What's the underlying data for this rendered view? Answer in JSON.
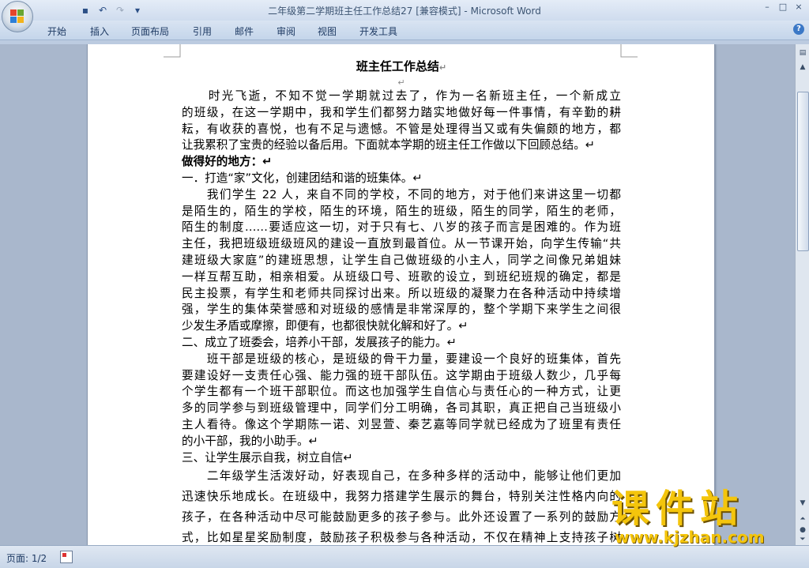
{
  "window": {
    "title_doc": "二年级第二学期班主任工作总结27 [兼容模式] - ",
    "title_app": "Microsoft Word",
    "controls": [
      "–",
      "□",
      "×"
    ]
  },
  "quick_access": {
    "save_icon": "save-icon",
    "undo_icon": "undo-icon",
    "redo_icon": "redo-icon",
    "customize_icon": "customize-icon",
    "save_glyph": "▪",
    "undo_glyph": "↶",
    "redo_glyph": "↷",
    "customize_glyph": "▾"
  },
  "ribbon": {
    "tabs": [
      "开始",
      "插入",
      "页面布局",
      "引用",
      "邮件",
      "审阅",
      "视图",
      "开发工具"
    ],
    "help": "?"
  },
  "document": {
    "title": "班主任工作总结",
    "para_mark": "↵",
    "lines": [
      "　　时光飞逝，不知不觉一学期就过去了，作为一名新班主任，一个新成立",
      "的班级，在这一学期中，我和学生们都努力踏实地做好每一件事情，有辛勤的耕",
      "耘，有收获的喜悦，也有不足与遗憾。不管是处理得当又或有失偏颇的地方，都",
      "让我累积了宝贵的经验以备后用。下面就本学期的班主任工作做以下回顾总结。↵",
      "做得好的地方：↵",
      "一．打造“家”文化，创建团结和谐的班集体。↵",
      "　　我们学生 22 人，来自不同的学校，不同的地方，对于他们来讲这里一切都",
      "是陌生的，陌生的学校，陌生的环境，陌生的班级，陌生的同学，陌生的老师，",
      "陌生的制度……要适应这一切，对于只有七、八岁的孩子而言是困难的。作为班",
      "主任，我把班级班级班风的建设一直放到最首位。从一节课开始，向学生传输“共",
      "建班级大家庭”的建班思想，让学生自己做班级的小主人，同学之间像兄弟姐妹",
      "一样互帮互助，相亲相爱。从班级口号、班歌的设立，到班纪班规的确定，都是",
      "民主投票，有学生和老师共同探讨出来。所以班级的凝聚力在各种活动中持续增",
      "强，学生的集体荣誉感和对班级的感情是非常深厚的，整个学期下来学生之间很",
      "少发生矛盾或摩擦，即便有，也都很快就化解和好了。↵",
      "二、成立了班委会，培养小干部，发展孩子的能力。↵",
      "　　班干部是班级的核心，是班级的骨干力量，要建设一个良好的班集体，首先",
      "要建设好一支责任心强、能力强的班干部队伍。这学期由于班级人数少，几乎每",
      "个学生都有一个班干部职位。而这也加强学生自信心与责任心的一种方式，让更",
      "多的同学参与到班级管理中，同学们分工明确，各司其职，真正把自己当班级小",
      "主人看待。像这个学期陈一诺、刘昱萱、秦艺嘉等同学就已经成为了班里有责任",
      "的小干部，我的小助手。↵",
      "三、让学生展示自我，树立自信↵",
      "　　二年级学生活泼好动，好表现自己，在多种多样的活动中，能够让他们更加",
      "迅速快乐地成长。在班级中，我努力搭建学生展示的舞台，特别关注性格内向的",
      "孩子，在各种活动中尽可能鼓励更多的孩子参与。此外还设置了一系列的鼓励方",
      "式，比如星星奖励制度，鼓励孩子积极参与各种活动，不仅在精神上支持孩子树"
    ]
  },
  "status": {
    "page": "页面: 1/2"
  },
  "watermark": {
    "title": "课件站",
    "url": "www.kjzhan.com"
  },
  "colors": {
    "accent": "#2b5797",
    "watermark": "#f4c50c"
  }
}
